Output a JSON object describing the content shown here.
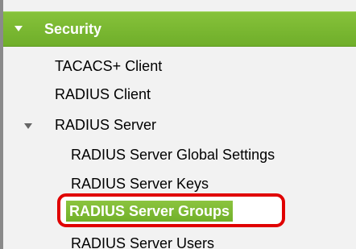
{
  "nav": {
    "security_header": "Security",
    "items": [
      {
        "label": "TACACS+ Client"
      },
      {
        "label": "RADIUS Client"
      },
      {
        "label": "RADIUS Server"
      },
      {
        "label": "RADIUS Server Global Settings"
      },
      {
        "label": "RADIUS Server Keys"
      },
      {
        "label": "RADIUS Server Groups"
      },
      {
        "label": "RADIUS Server Users"
      }
    ]
  },
  "colors": {
    "header_bg": "#7bb730",
    "selected_bg": "#7dba33",
    "highlight_border": "#e00000",
    "panel_bg": "#f2f2f2"
  }
}
